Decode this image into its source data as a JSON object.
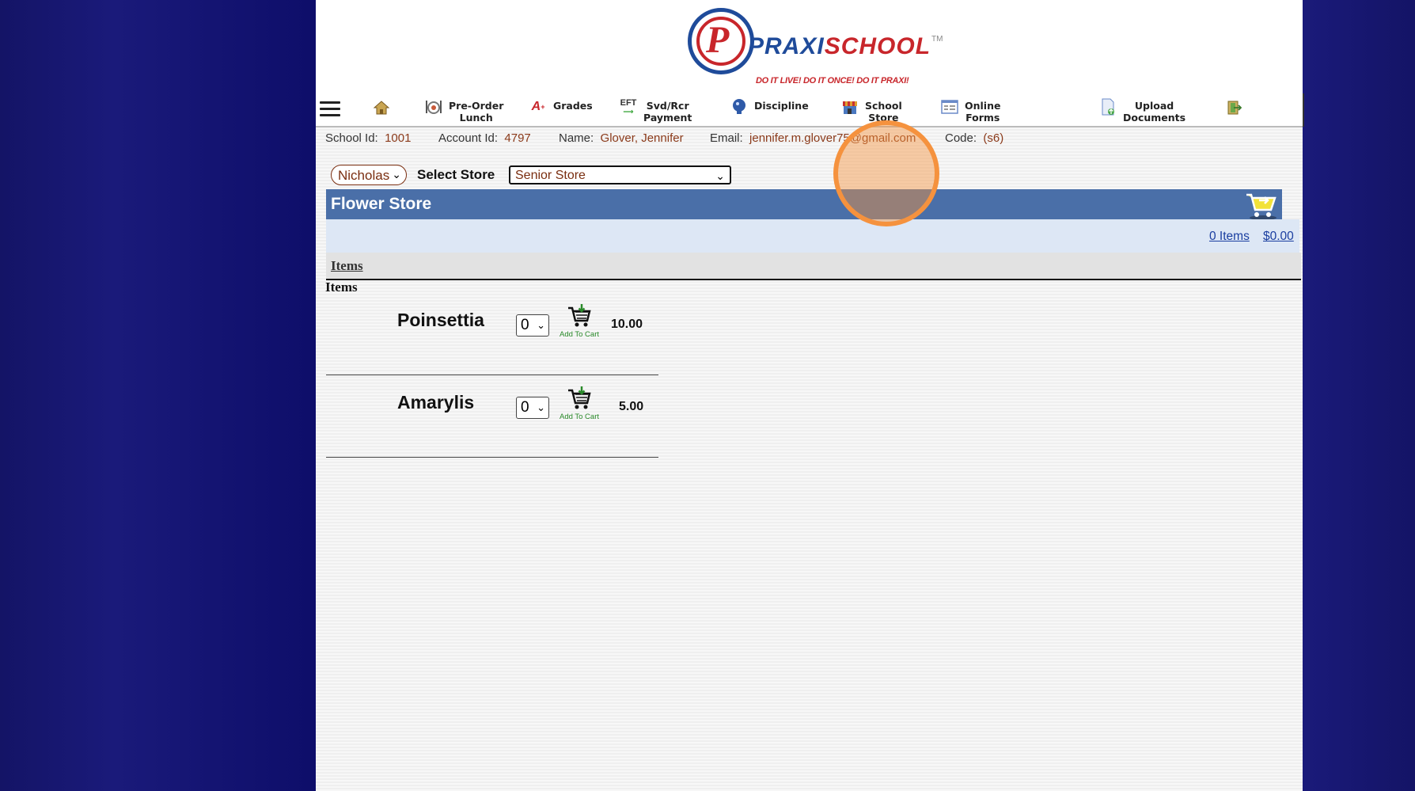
{
  "logo": {
    "brand_a": "PRAXI",
    "brand_b": "SCHOOL",
    "tm": "TM",
    "tagline": "DO IT LIVE!   DO IT ONCE!   DO IT PRAXI!"
  },
  "nav": {
    "items": [
      {
        "label": "Pre-Order\nLunch",
        "icon": "lunch-icon"
      },
      {
        "label": "Grades",
        "icon": "grades-icon"
      },
      {
        "label": "Svd/Rcr\nPayment",
        "icon": "eft-icon"
      },
      {
        "label": "Discipline",
        "icon": "discipline-icon"
      },
      {
        "label": "School\nStore",
        "icon": "store-icon"
      },
      {
        "label": "Online\nForms",
        "icon": "forms-icon"
      },
      {
        "label": "Upload\nDocuments",
        "icon": "upload-icon"
      }
    ],
    "eft_text": "EFT",
    "grades_icon_text": "A"
  },
  "info": {
    "school_id_label": "School Id:",
    "school_id": "1001",
    "account_id_label": "Account Id:",
    "account_id": "4797",
    "name_label": "Name:",
    "name": "Glover, Jennifer",
    "email_label": "Email:",
    "email": "jennifer.m.glover75@gmail.com",
    "code_label": "Code:",
    "code": "(s6)"
  },
  "controls": {
    "student": "Nicholas",
    "select_store_label": "Select Store",
    "store": "Senior Store"
  },
  "store": {
    "title": "Flower Store",
    "cart_items": "0 Items",
    "cart_total": "$0.00",
    "items_tab": "Items",
    "items_heading": "Items"
  },
  "products": [
    {
      "name": "Poinsettia",
      "qty": "0",
      "add_label": "Add To Cart",
      "price": "10.00"
    },
    {
      "name": "Amarylis",
      "qty": "0",
      "add_label": "Add To Cart",
      "price": "5.00"
    }
  ],
  "colors": {
    "accent_blue": "#4a6fa8",
    "brand_red": "#c8262b",
    "brand_blue": "#1f4b9a",
    "highlight": "#f5923e"
  }
}
